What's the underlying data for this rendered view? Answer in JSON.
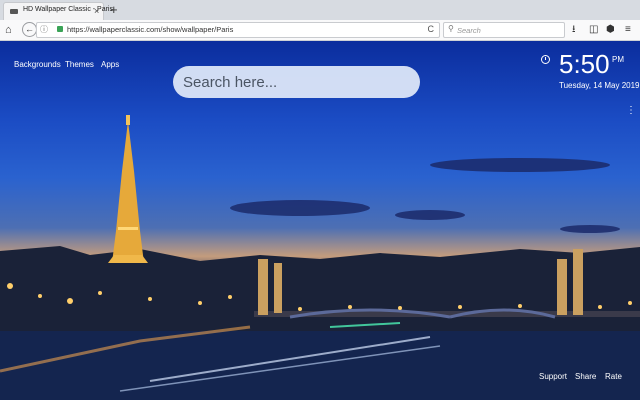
{
  "browser": {
    "tab_title": "HD Wallpaper Classic - Paris",
    "tab_close": "×",
    "new_tab": "+",
    "url": "https://wallpaperclassic.com/show/wallpaper/Paris",
    "search_placeholder": "Search",
    "reload": "C"
  },
  "page": {
    "nav": [
      "Backgrounds",
      "Themes",
      "Apps"
    ],
    "search_placeholder": "Search here...",
    "clock": {
      "time": "5:50",
      "ampm": "PM",
      "date": "Tuesday, 14 May 2019"
    },
    "footer": [
      "Support",
      "Share",
      "Rate"
    ]
  },
  "icons": {
    "home": "home-icon",
    "back": "back-arrow-icon",
    "info": "info-icon",
    "lock": "lock-icon",
    "reload": "reload-icon",
    "search": "search-icon",
    "download": "download-icon",
    "sidebar": "sidebar-icon",
    "extension": "extension-icon",
    "menu": "hamburger-menu-icon",
    "clock": "clock-icon",
    "more": "more-icon"
  },
  "colors": {
    "accent": "#3aa357",
    "sky_top": "#0b2d9d",
    "text_on_image": "#ffffff"
  }
}
